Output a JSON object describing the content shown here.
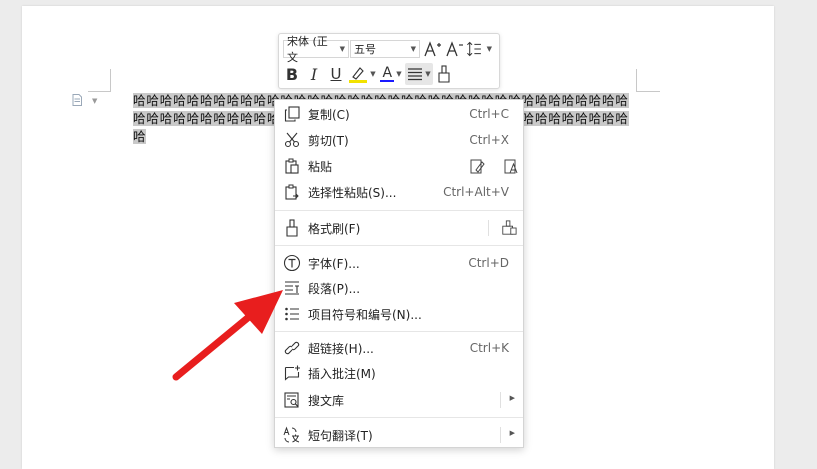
{
  "document": {
    "selected_text": "哈哈哈哈哈哈哈哈哈哈哈哈哈哈哈哈哈哈哈哈哈哈哈哈哈哈哈哈哈哈哈哈哈哈哈哈哈哈哈哈哈哈哈哈哈哈哈哈哈哈哈哈哈哈哈哈哈哈哈哈哈哈哈哈哈哈哈哈哈哈哈哈哈哈哈"
  },
  "mini_toolbar": {
    "font_name": "宋体 (正文",
    "font_size": "五号",
    "grow_font_icon": "A+",
    "shrink_font_icon": "A-",
    "bold": "B",
    "italic": "I",
    "underline": "U",
    "font_color_letter": "A",
    "colors": {
      "highlight": "#f2e200",
      "font": "#c00000",
      "font_underline": "#1a1aff"
    }
  },
  "context_menu": {
    "items": [
      {
        "icon": "copy-icon",
        "label": "复制(C)",
        "shortcut": "Ctrl+C"
      },
      {
        "icon": "cut-icon",
        "label": "剪切(T)",
        "shortcut": "Ctrl+X"
      },
      {
        "icon": "paste-icon",
        "label": "粘贴",
        "shortcut": ""
      },
      {
        "icon": "paste-special-icon",
        "label": "选择性粘贴(S)...",
        "shortcut": "Ctrl+Alt+V"
      },
      {
        "icon": "format-painter-icon",
        "label": "格式刷(F)",
        "shortcut": ""
      },
      {
        "icon": "font-icon",
        "label": "字体(F)...",
        "shortcut": "Ctrl+D"
      },
      {
        "icon": "paragraph-icon",
        "label": "段落(P)...",
        "shortcut": ""
      },
      {
        "icon": "bullets-icon",
        "label": "项目符号和编号(N)...",
        "shortcut": ""
      },
      {
        "icon": "hyperlink-icon",
        "label": "超链接(H)...",
        "shortcut": "Ctrl+K"
      },
      {
        "icon": "insert-comment-icon",
        "label": "插入批注(M)",
        "shortcut": ""
      },
      {
        "icon": "search-library-icon",
        "label": "搜文库",
        "shortcut": ""
      },
      {
        "icon": "translate-icon",
        "label": "短句翻译(T)",
        "shortcut": ""
      }
    ]
  },
  "annotation": {
    "arrow_color": "#e81e1e"
  }
}
